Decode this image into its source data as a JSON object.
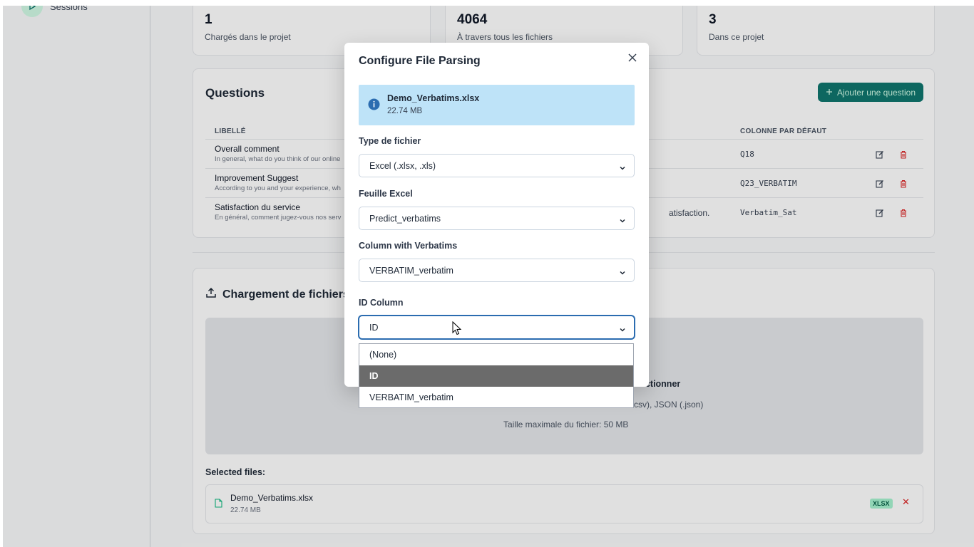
{
  "sidebar": {
    "sessions_label": "Sessions"
  },
  "stats": [
    {
      "value": "1",
      "label": "Chargés dans le projet"
    },
    {
      "value": "4064",
      "label": "À travers tous les fichiers"
    },
    {
      "value": "3",
      "label": "Dans ce projet"
    }
  ],
  "questions": {
    "title": "Questions",
    "add_button": "Ajouter une question",
    "col_label": "LIBELLÉ",
    "col_default": "COLONNE PAR DÉFAUT",
    "rows": [
      {
        "label": "Overall comment",
        "desc": "In general, what do you think of our online",
        "extra": "",
        "column": "Q18"
      },
      {
        "label": "Improvement Suggest",
        "desc": "According to you and your experience, wh",
        "extra": "",
        "column": "Q23_VERBATIM"
      },
      {
        "label": "Satisfaction du service",
        "desc": "En général, comment jugez-vous nos serv",
        "extra": "atisfaction.",
        "column": "Verbatim_Sat"
      }
    ]
  },
  "upload": {
    "title": "Chargement de fichiers",
    "dz_select": "ectionner",
    "dz_formats": "csv), JSON (.json)",
    "dz_max": "Taille maximale du fichier: 50 MB",
    "selected_label": "Selected files:",
    "file_name": "Demo_Verbatims.xlsx",
    "file_size": "22.74 MB",
    "file_badge": "XLSX",
    "remove_glyph": "✕"
  },
  "modal": {
    "title": "Configure File Parsing",
    "info_name": "Demo_Verbatims.xlsx",
    "info_size": "22.74 MB",
    "fields": [
      {
        "label": "Type de fichier",
        "value": "Excel (.xlsx, .xls)"
      },
      {
        "label": "Feuille Excel",
        "value": "Predict_verbatims"
      },
      {
        "label": "Column with Verbatims",
        "value": "VERBATIM_verbatim"
      },
      {
        "label": "ID Column",
        "value": "ID"
      }
    ],
    "dropdown_options": [
      "(None)",
      "ID",
      "VERBATIM_verbatim"
    ],
    "dropdown_selected": "ID"
  },
  "colors": {
    "accent": "#0f766e",
    "info_bg": "#bee3f8",
    "danger": "#dc2626",
    "focus": "#2b6cb0"
  },
  "icons": [
    "play-icon",
    "plus-icon",
    "edit-icon",
    "trash-icon",
    "upload-icon",
    "file-icon",
    "close-icon",
    "info-icon",
    "chevron-down-icon",
    "cursor-icon"
  ]
}
